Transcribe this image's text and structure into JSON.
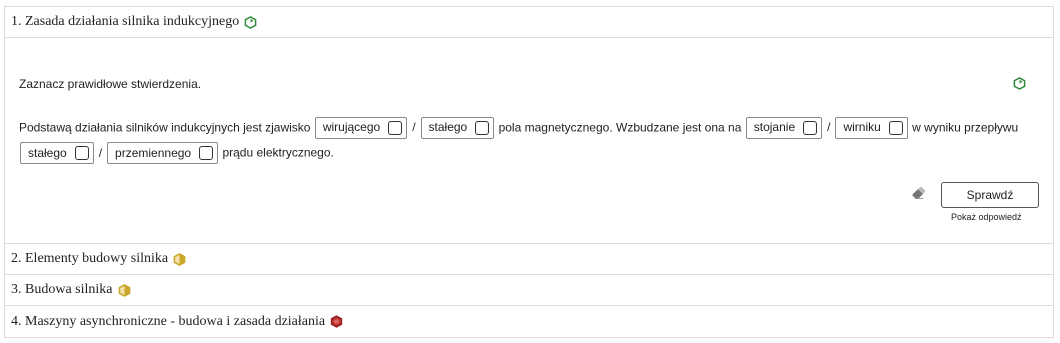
{
  "sections": [
    {
      "title": "1. Zasada działania silnika indukcyjnego",
      "icon": "green-hexagon-icon",
      "color": "#2e8b3a"
    },
    {
      "title": "2. Elementy budowy silnika",
      "icon": "yellow-hexagon-icon",
      "color": "#c9a62a"
    },
    {
      "title": "3. Budowa silnika",
      "icon": "yellow-hexagon-icon",
      "color": "#c9a62a"
    },
    {
      "title": "4. Maszyny asynchroniczne - budowa i zasada działania",
      "icon": "red-hexagon-icon",
      "color": "#b52a2a"
    }
  ],
  "exercise": {
    "instruction": "Zaznacz prawidłowe stwierdzenia.",
    "text1": "Podstawą działania silników indukcyjnych jest zjawisko",
    "opt1a": "wirującego",
    "opt1b": "stałego",
    "text2": "pola magnetycznego. Wzbudzane jest ona na",
    "opt2a": "stojanie",
    "opt2b": "wirniku",
    "text3": "w wyniku przepływu",
    "opt3a": "stałego",
    "opt3b": "przemiennego",
    "text4": "prądu elektrycznego.",
    "slash": "/",
    "check_label": "Sprawdź",
    "show_answer_label": "Pokaż odpowiedź"
  }
}
